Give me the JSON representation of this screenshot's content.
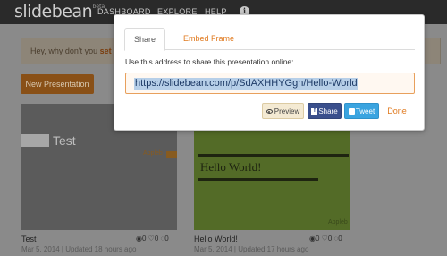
{
  "nav": {
    "logo": "slidebean",
    "logo_badge": "beta",
    "links": [
      "DASHBOARD",
      "EXPLORE",
      "HELP"
    ]
  },
  "notice": {
    "text": "Hey, why don't you ",
    "link": "set a"
  },
  "new_presentation_label": "New Presentation",
  "cards": [
    {
      "thumb_title": "Test",
      "thumb_tag": "Appleb",
      "title": "Test",
      "stats": "◉0 ♡0 ◌0",
      "date": "Mar 5, 2014 | Updated 18 hours ago"
    },
    {
      "thumb_title": "Hello World!",
      "thumb_tag": "Appleb",
      "title": "Hello World!",
      "stats": "◉0 ♡0 ◌0",
      "date": "Mar 5, 2014 | Updated 17 hours ago"
    }
  ],
  "modal": {
    "tabs": [
      "Share",
      "Embed Frame"
    ],
    "active_tab": "Share",
    "description": "Use this address to share this presentation online:",
    "url": "https://slidebean.com/p/SdAXHHYGgn/Hello-World",
    "buttons": {
      "preview": "Preview",
      "share": "Share",
      "tweet": "Tweet",
      "done": "Done"
    }
  },
  "colors": {
    "accent": "#e07a1f",
    "facebook": "#3a4f8c",
    "twitter": "#3aa4e0"
  }
}
